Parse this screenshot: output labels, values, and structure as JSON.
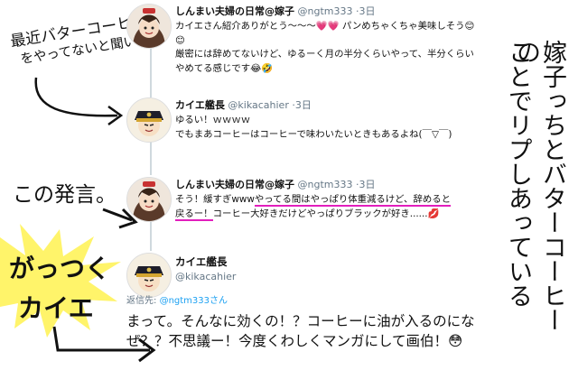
{
  "tweets": [
    {
      "name": "しんまい夫婦の日常@嫁子",
      "handle": "@ngtm333",
      "sep": "·",
      "time": "3日",
      "text1": "カイエさん紹介ありがとう〜〜〜💗💗 パンめちゃくちゃ美味しそう😊😊",
      "text2": "厳密には辞めてないけど、ゆるーく月の半分くらいやって、半分くらいやめてる感じです😂🤣"
    },
    {
      "name": "カイエ艦長",
      "handle": "@kikacahier",
      "sep": "·",
      "time": "3日",
      "text1": "ゆるい！ｗｗｗｗ",
      "text2": "でもまあコーヒーはコーヒーで味わいたいときもあるよね(￣▽￣)"
    },
    {
      "name": "しんまい夫婦の日常@嫁子",
      "handle": "@ngtm333",
      "sep": "·",
      "time": "3日",
      "text_a": "そう！緩すぎwww",
      "text_b": "やってる間はやっぱり体重減るけど、辞めると",
      "text_c": "戻るー！",
      "text_d": "コーヒー大好きだけどやっぱりブラックが好き......💋"
    },
    {
      "name": "カイエ艦長",
      "handle": "@kikacahier",
      "reply_label": "返信先:",
      "reply_link": "@ngtm333さん",
      "text": "まって。そんなに効くの！？コーヒーに油が入るのになぜ？？不思議ー！今度くわしくマンガにして画伯！😳"
    }
  ],
  "annotations": {
    "note1_line1": "最近バターコーヒー",
    "note1_line2": "をやってないと聞いて…",
    "note2": "この発言。",
    "note3_line1": "がっつく",
    "note3_line2": "カイエ",
    "vertical_col1": "嫁子っちとバターコーヒーの",
    "vertical_col2": "ことでリプしあっている"
  }
}
